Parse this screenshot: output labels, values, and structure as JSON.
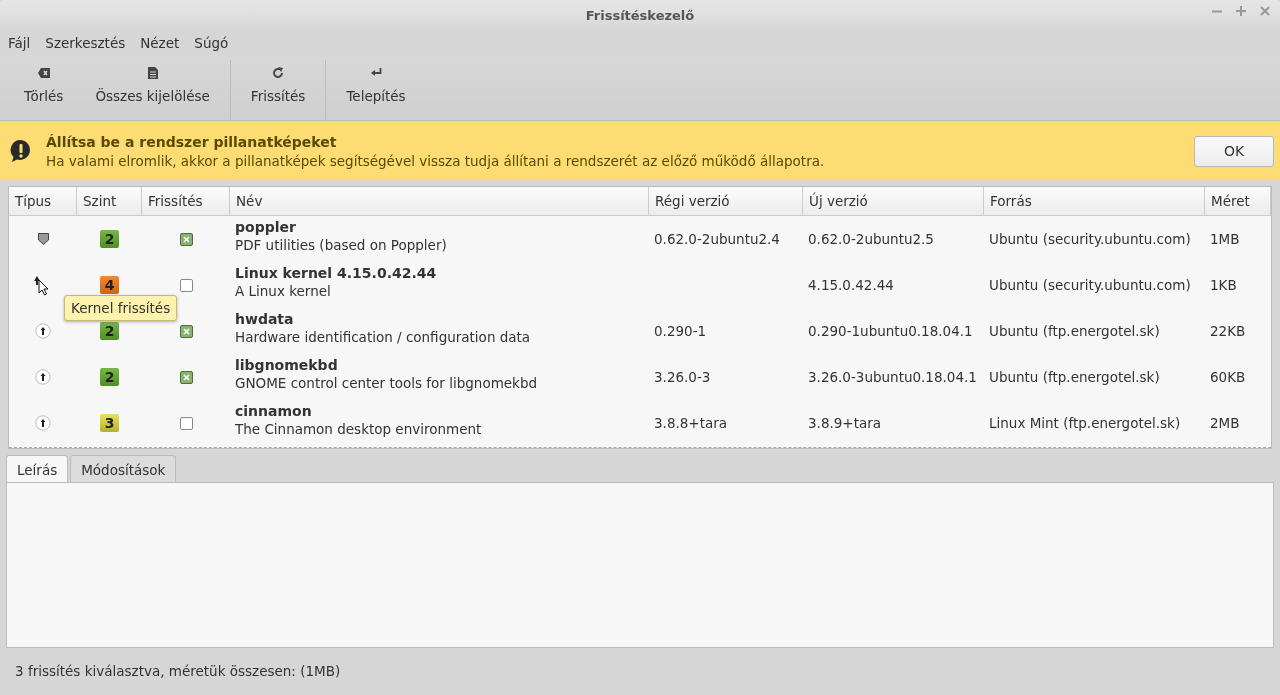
{
  "window": {
    "title": "Frissítéskezelő"
  },
  "menu": [
    "Fájl",
    "Szerkesztés",
    "Nézet",
    "Súgó"
  ],
  "toolbar": [
    [
      {
        "label": "Törlés",
        "kind": "clear"
      },
      {
        "label": "Összes kijelölése",
        "kind": "document"
      }
    ],
    [
      {
        "label": "Frissítés",
        "kind": "refresh"
      }
    ],
    [
      {
        "label": "Telepítés",
        "kind": "install"
      }
    ]
  ],
  "banner": {
    "title": "Állítsa be a rendszer pillanatképeket",
    "message": "Ha valami elromlik, akkor a pillanatképek segítségével vissza tudja állítani a rendszerét az előző működő állapotra.",
    "button": "OK"
  },
  "table": {
    "columns": [
      "Típus",
      "Szint",
      "Frissítés",
      "Név",
      "Régi verzió",
      "Új verzió",
      "Forrás",
      "Méret"
    ],
    "rows": [
      {
        "kind": "security",
        "level": "2",
        "checked": true,
        "name": "poppler",
        "description": "PDF utilities (based on Poppler)",
        "old_version": "0.62.0-2ubuntu2.4",
        "new_version": "0.62.0-2ubuntu2.5",
        "source": "Ubuntu (security.ubuntu.com)",
        "size": "1MB"
      },
      {
        "kind": "kernel",
        "level": "4",
        "checked": false,
        "name": "Linux kernel 4.15.0.42.44",
        "description": "A Linux kernel",
        "new_version": "4.15.0.42.44",
        "source": "Ubuntu (security.ubuntu.com)",
        "size": "1KB"
      },
      {
        "kind": "package",
        "level": "2",
        "checked": true,
        "name": "hwdata",
        "description": "Hardware identification / configuration data",
        "old_version": "0.290-1",
        "new_version": "0.290-1ubuntu0.18.04.1",
        "source": "Ubuntu (ftp.energotel.sk)",
        "size": "22KB"
      },
      {
        "kind": "package",
        "level": "2",
        "checked": true,
        "name": "libgnomekbd",
        "description": "GNOME control center tools for libgnomekbd",
        "old_version": "3.26.0-3",
        "new_version": "3.26.0-3ubuntu0.18.04.1",
        "source": "Ubuntu (ftp.energotel.sk)",
        "size": "60KB"
      },
      {
        "kind": "package",
        "level": "3",
        "checked": false,
        "name": "cinnamon",
        "description": "The Cinnamon desktop environment",
        "old_version": "3.8.8+tara",
        "new_version": "3.8.9+tara",
        "source": "Linux Mint (ftp.energotel.sk)",
        "size": "2MB"
      }
    ],
    "tooltip": "Kernel frissítés"
  },
  "tabs": [
    {
      "label": "Leírás",
      "selected": true
    },
    {
      "label": "Módosítások",
      "selected": false
    }
  ],
  "status_bar": "3 frissítés kiválasztva, méretük összesen: (1MB)"
}
